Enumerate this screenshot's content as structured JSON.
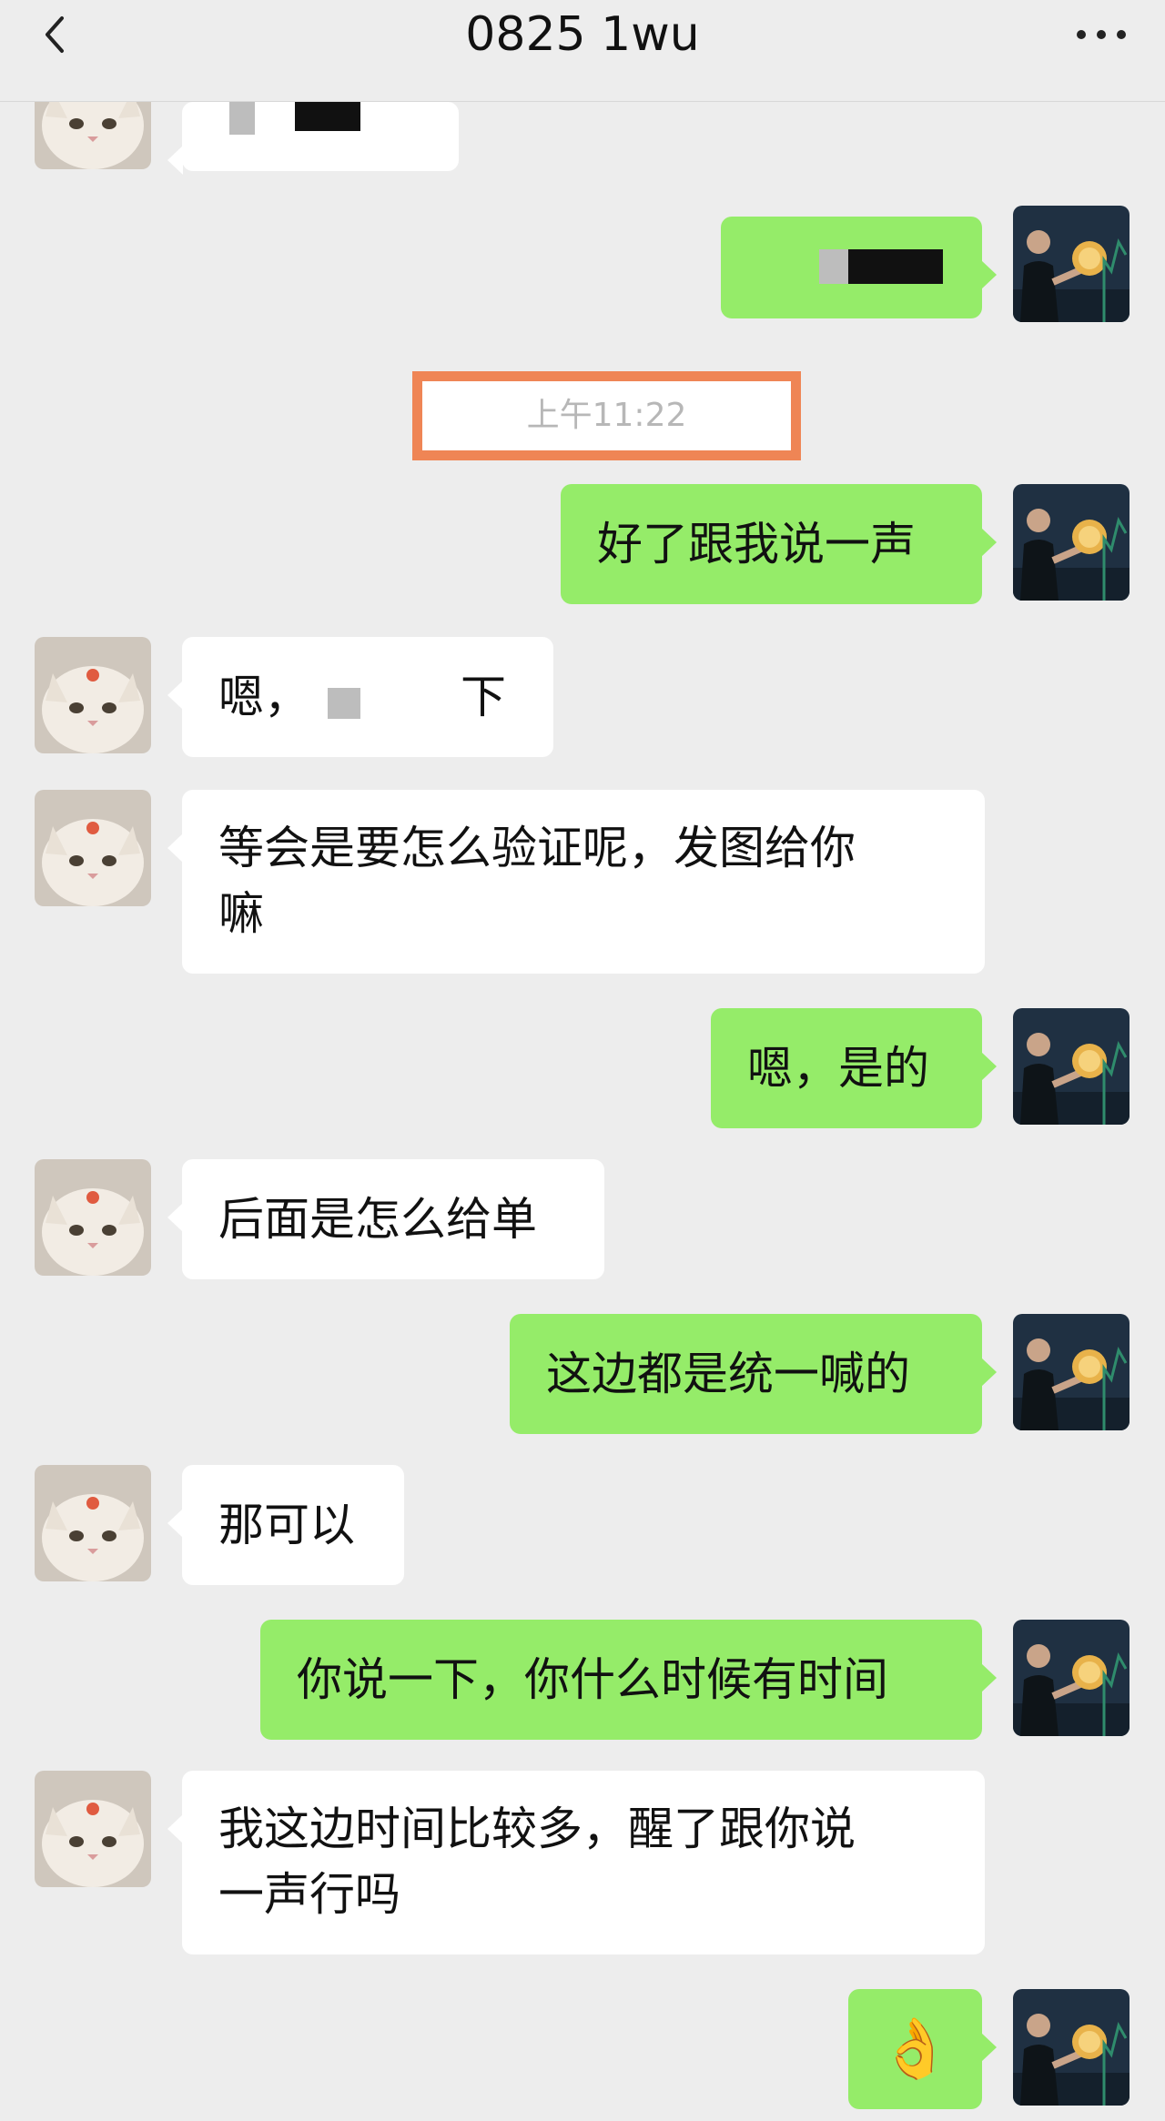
{
  "header": {
    "title": "0825 1wu"
  },
  "timestamp": "上午11:22",
  "messages": [
    {
      "side": "in",
      "text": ""
    },
    {
      "side": "out",
      "text": ""
    },
    {
      "side": "out",
      "text": "好了跟我说一声"
    },
    {
      "side": "in",
      "text": "嗯，",
      "text_end": "下"
    },
    {
      "side": "in",
      "text": "等会是要怎么验证呢，发图给你",
      "text_line2": "嘛"
    },
    {
      "side": "out",
      "text": "嗯，是的"
    },
    {
      "side": "in",
      "text": "后面是怎么给单"
    },
    {
      "side": "out",
      "text": "这边都是统一喊的"
    },
    {
      "side": "in",
      "text": "那可以"
    },
    {
      "side": "out",
      "text": "你说一下，你什么时候有时间"
    },
    {
      "side": "in",
      "text": "我这边时间比较多，醒了跟你说",
      "text_line2": "一声行吗"
    },
    {
      "side": "out",
      "text": "👌"
    }
  ],
  "icons": {
    "back": "chevron-left-icon",
    "more": "more-dots-icon"
  },
  "colors": {
    "background": "#ededed",
    "incoming_bubble": "#ffffff",
    "outgoing_bubble": "#95ec69",
    "highlight_box": "#ef8555"
  }
}
